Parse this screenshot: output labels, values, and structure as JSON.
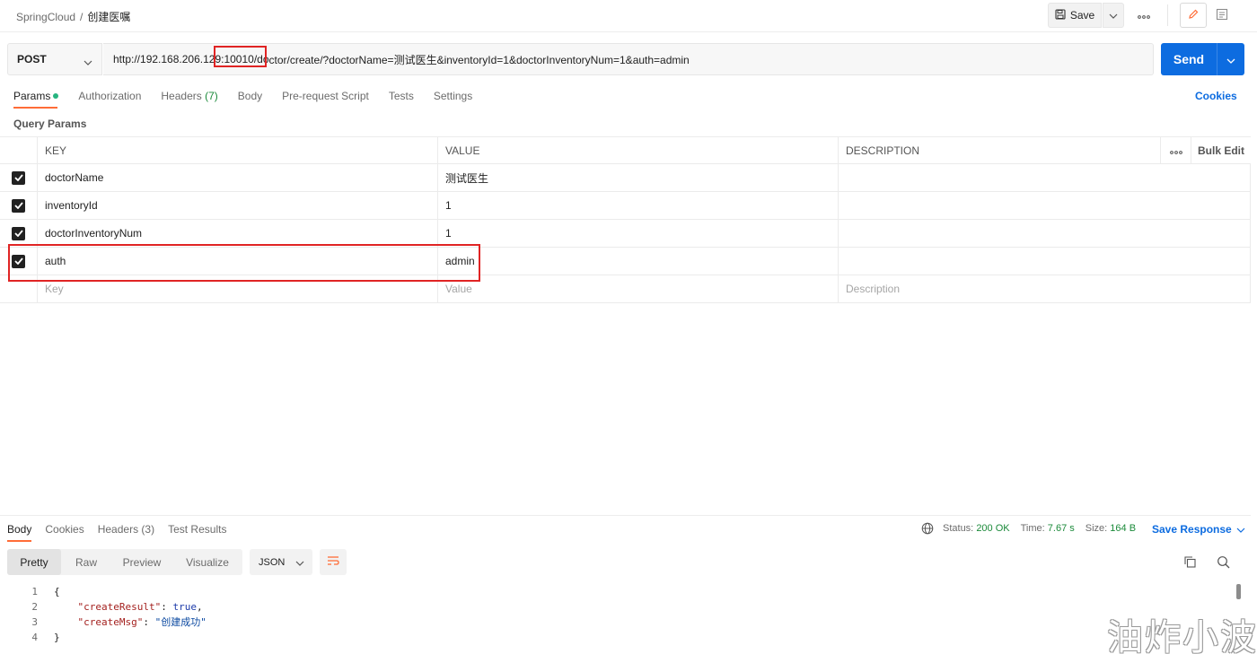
{
  "breadcrumb": {
    "collection": "SpringCloud",
    "separator": "/",
    "request": "创建医嘱"
  },
  "toolbar": {
    "save_label": "Save",
    "more_label": "ooo"
  },
  "request": {
    "method": "POST",
    "url_parts": {
      "prefix": "http://192.168.206.12",
      "highlighted": "9:10010/do",
      "suffix": "ctor/create/?doctorName=测试医生&inventoryId=1&doctorInventoryNum=1&auth=admin"
    },
    "send_label": "Send"
  },
  "tabs": {
    "params": "Params",
    "authorization": "Authorization",
    "headers": "Headers",
    "headers_count": "(7)",
    "body": "Body",
    "prerequest": "Pre-request Script",
    "tests": "Tests",
    "settings": "Settings",
    "cookies": "Cookies"
  },
  "query_params": {
    "section_label": "Query Params",
    "columns": {
      "key": "KEY",
      "value": "VALUE",
      "description": "DESCRIPTION",
      "more": "ooo",
      "bulk_edit": "Bulk Edit"
    },
    "rows": [
      {
        "key": "doctorName",
        "value": "测试医生",
        "checked": true
      },
      {
        "key": "inventoryId",
        "value": "1",
        "checked": true
      },
      {
        "key": "doctorInventoryNum",
        "value": "1",
        "checked": true
      },
      {
        "key": "auth",
        "value": "admin",
        "checked": true
      }
    ],
    "placeholders": {
      "key": "Key",
      "value": "Value",
      "description": "Description"
    }
  },
  "response": {
    "tabs": {
      "body": "Body",
      "cookies": "Cookies",
      "headers": "Headers",
      "headers_count": "(3)",
      "test_results": "Test Results"
    },
    "status": {
      "status_label": "Status:",
      "status_value": "200 OK",
      "time_label": "Time:",
      "time_value": "7.67 s",
      "size_label": "Size:",
      "size_value": "164 B"
    },
    "save_response": "Save Response",
    "formats": [
      "Pretty",
      "Raw",
      "Preview",
      "Visualize"
    ],
    "active_format": "Pretty",
    "language": "JSON",
    "body_lines": [
      {
        "n": "1",
        "text": "{"
      },
      {
        "n": "2",
        "key": "\"createResult\"",
        "sep": ": ",
        "value": "true",
        "end": ","
      },
      {
        "n": "3",
        "key": "\"createMsg\"",
        "sep": ": ",
        "value": "\"创建成功\"",
        "end": ""
      },
      {
        "n": "4",
        "text": "}"
      }
    ]
  },
  "watermark": "油炸小波",
  "colors": {
    "accent": "#0d6ce0",
    "tab_active": "#ff6c37",
    "highlight_box": "#e02424",
    "status_ok": "#1b8a3a"
  }
}
